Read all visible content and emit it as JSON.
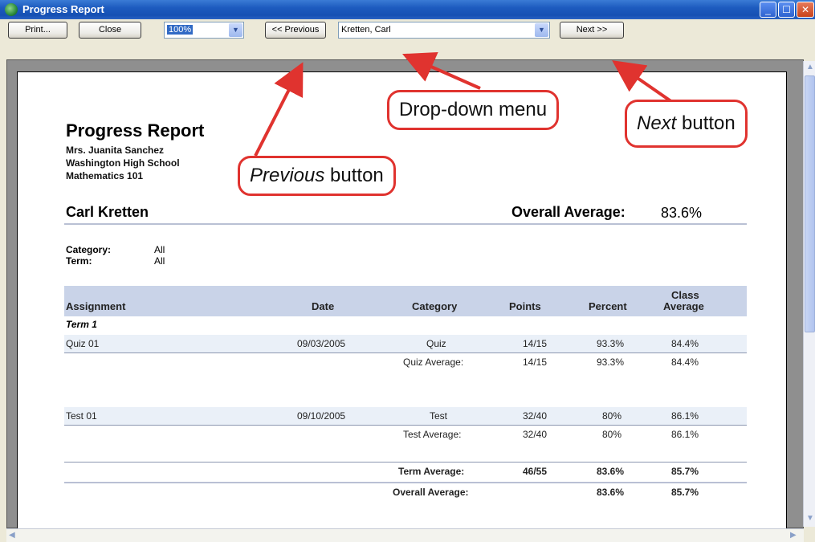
{
  "window": {
    "title": "Progress Report"
  },
  "toolbar": {
    "print_label": "Print...",
    "close_label": "Close",
    "zoom_value": "100%",
    "previous_label": "<< Previous",
    "student_select_value": "Kretten, Carl",
    "next_label": "Next >>"
  },
  "report": {
    "title": "Progress Report",
    "teacher": "Mrs. Juanita Sanchez",
    "school": "Washington High School",
    "course": "Mathematics 101",
    "student_name": "Carl Kretten",
    "overall_label": "Overall Average:",
    "overall_value": "83.6%",
    "category_label": "Category:",
    "category_value": "All",
    "term_label": "Term:",
    "term_value": "All",
    "columns": {
      "assignment": "Assignment",
      "date": "Date",
      "category": "Category",
      "points": "Points",
      "percent": "Percent",
      "class_avg_1": "Class",
      "class_avg_2": "Average"
    },
    "term_heading": "Term 1",
    "rows": [
      {
        "assignment": "Quiz 01",
        "date": "09/03/2005",
        "category": "Quiz",
        "points": "14/15",
        "percent": "93.3%",
        "class_avg": "84.4%"
      },
      {
        "category": "Quiz Average:",
        "points": "14/15",
        "percent": "93.3%",
        "class_avg": "84.4%"
      },
      {
        "assignment": "Test 01",
        "date": "09/10/2005",
        "category": "Test",
        "points": "32/40",
        "percent": "80%",
        "class_avg": "86.1%"
      },
      {
        "category": "Test Average:",
        "points": "32/40",
        "percent": "80%",
        "class_avg": "86.1%"
      },
      {
        "category": "Term Average:",
        "points": "46/55",
        "percent": "83.6%",
        "class_avg": "85.7%"
      },
      {
        "category": "Overall Average:",
        "percent": "83.6%",
        "class_avg": "85.7%"
      }
    ]
  },
  "callouts": {
    "dropdown": "Drop-down menu",
    "next_italic": "Next",
    "next_rest": " button",
    "previous_italic": "Previous",
    "previous_rest": " button"
  },
  "colors": {
    "callout_border": "#e0332f",
    "header_band": "#c9d3e8",
    "title_bar": "#1d5bbf"
  }
}
